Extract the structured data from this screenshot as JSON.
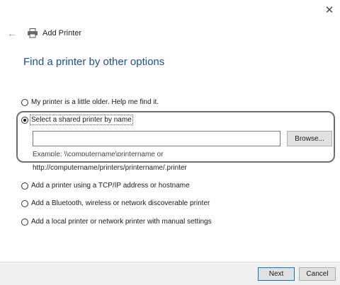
{
  "window": {
    "close_glyph": "✕",
    "back_glyph": "←",
    "title": "Add Printer"
  },
  "heading": "Find a printer by other options",
  "options": [
    {
      "label": "My printer is a little older. Help me find it.",
      "selected": false
    },
    {
      "label": "Select a shared printer by name",
      "selected": true
    },
    {
      "label": "Add a printer using a TCP/IP address or hostname",
      "selected": false
    },
    {
      "label": "Add a Bluetooth, wireless or network discoverable printer",
      "selected": false
    },
    {
      "label": "Add a local printer or network printer with manual settings",
      "selected": false
    }
  ],
  "shared": {
    "input_value": "",
    "browse_label": "Browse...",
    "example_line1": "Example: \\\\computername\\printername or",
    "example_line2": "http://computername/printers/printername/.printer"
  },
  "footer": {
    "next_label": "Next",
    "cancel_label": "Cancel"
  },
  "colors": {
    "heading": "#1f4e9a",
    "highlight_border": "#707070",
    "default_button_border": "#0078d7"
  }
}
